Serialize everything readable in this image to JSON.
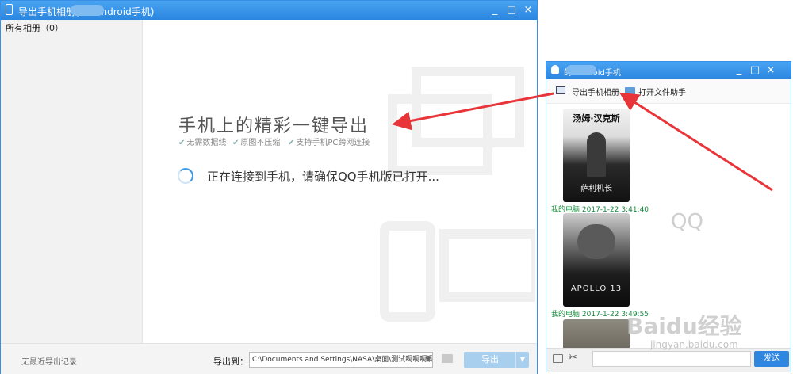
{
  "main_window": {
    "title": "导出手机相册(               的 Android手机)",
    "minimize": "_",
    "maximize": "□",
    "close": "×"
  },
  "sidebar": {
    "items": [
      {
        "label": "所有相册（0）"
      }
    ]
  },
  "content": {
    "headline": "手机上的精彩一键导出",
    "features": [
      "无需数据线",
      "原图不压缩",
      "支持手机PC跨网连接"
    ],
    "check_glyph": "✔",
    "status": "正在连接到手机，请确保QQ手机版已打开..."
  },
  "footer": {
    "no_record": "无最近导出记录",
    "export_to_label": "导出到：",
    "path_value": "C:\\Documents and Settings\\NASA\\桌面\\测试啊啊啊啊啊",
    "export_button": "导出",
    "dropdown_glyph": "▼"
  },
  "chat_window": {
    "title": "            的 Android手机",
    "minimize": "_",
    "maximize": "□",
    "close": "×",
    "toolbar": {
      "export_album": "导出手机相册",
      "open_file_helper": "打开文件助手"
    },
    "messages": [
      {
        "sender": "我的电脑",
        "time": "2017-1-22 3:41:40",
        "poster_top": "汤姆·汉克斯",
        "poster_title": "萨利机长"
      },
      {
        "sender": "我的电脑",
        "time": "2017-1-22 3:49:55",
        "poster_title": "APOLLO 13"
      }
    ],
    "send_button": "发送"
  },
  "watermark": {
    "qq": "QQ",
    "baidu": "Baidu经验",
    "url": "jingyan.baidu.com"
  },
  "colors": {
    "title_bar": "#2a86e0",
    "accent": "#3a9be8",
    "arrow": "#e8353a",
    "timestamp": "#148a3b"
  }
}
